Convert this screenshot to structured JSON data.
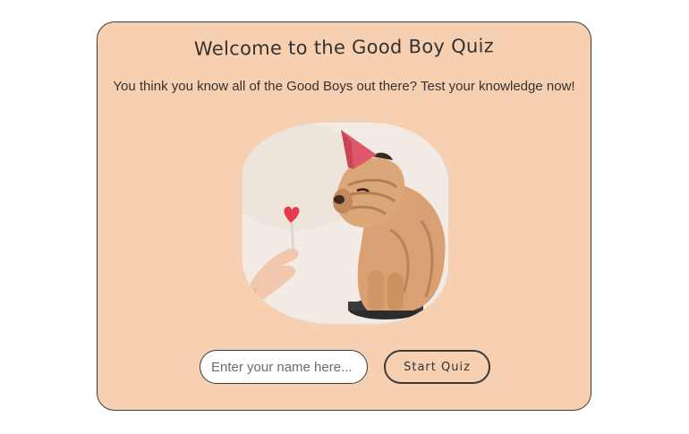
{
  "quiz": {
    "title": "Welcome to the Good Boy Quiz",
    "subtitle": "You think you know all of the Good Boys out there? Test your knowledge now!",
    "name_placeholder": "Enter your name here...",
    "name_value": "",
    "start_label": "Start Quiz"
  },
  "colors": {
    "card_background": "#f7cfb1",
    "border": "#3a3a3a",
    "text": "#333333"
  }
}
